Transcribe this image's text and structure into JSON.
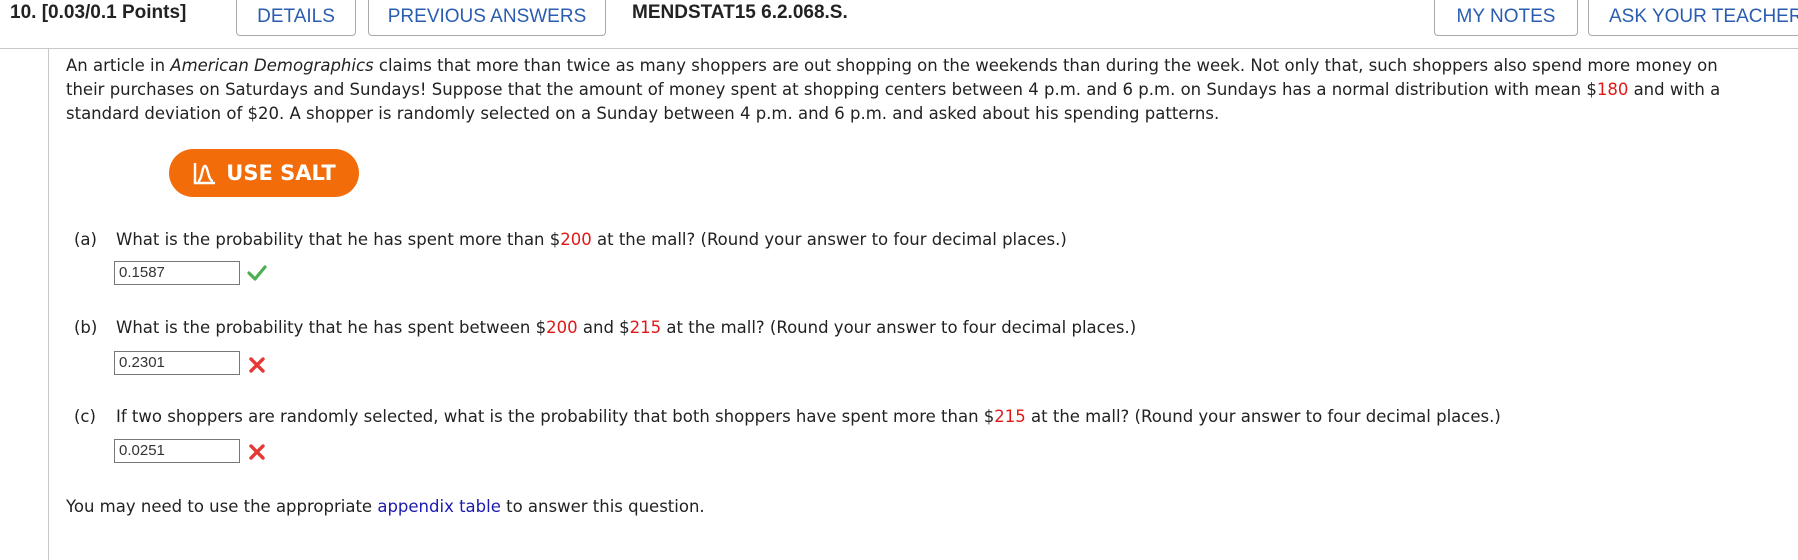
{
  "header": {
    "question_number": "10.",
    "points": "[0.03/0.1 Points]",
    "tabs": {
      "details": "DETAILS",
      "previous_answers": "PREVIOUS ANSWERS",
      "my_notes": "MY NOTES",
      "ask_teacher": "ASK YOUR TEACHER"
    },
    "code": "MENDSTAT15 6.2.068.S."
  },
  "intro": {
    "t1": "An article in ",
    "italic": "American Demographics",
    "t2": " claims that more than twice as many shoppers are out shopping on the weekends than during the week. Not only that, such shoppers also spend more money on their purchases on Saturdays and Sundays! Suppose that the amount of money spent at shopping centers between 4 p.m. and 6 p.m. on Sundays has a normal distribution with mean $",
    "mean": "180",
    "t3": " and with a standard deviation of $20. A shopper is randomly selected on a Sunday between 4 p.m. and 6 p.m. and asked about his spending patterns."
  },
  "salt_button": {
    "label": "USE SALT",
    "icon": "salt-chart-icon"
  },
  "parts": [
    {
      "letter": "(a)",
      "pre": "What is the probability that he has spent more than $",
      "v1": "200",
      "post": " at the mall? (Round your answer to four decimal places.)",
      "answer": "0.1587",
      "status": "correct"
    },
    {
      "letter": "(b)",
      "pre": "What is the probability that he has spent between $",
      "v1": "200",
      "mid": " and $",
      "v2": "215",
      "post": " at the mall? (Round your answer to four decimal places.)",
      "answer": "0.2301",
      "status": "incorrect"
    },
    {
      "letter": "(c)",
      "pre": "If two shoppers are randomly selected, what is the probability that both shoppers have spent more than $",
      "v1": "215",
      "post": " at the mall? (Round your answer to four decimal places.)",
      "answer": "0.0251",
      "status": "incorrect"
    }
  ],
  "footer": {
    "pre": "You may need to use the appropriate ",
    "link": "appendix table",
    "post": " to answer this question."
  },
  "colors": {
    "accent_link": "#2a5db0",
    "salt_orange": "#f36c0a",
    "value_red": "#e01818",
    "correct_green": "#4caf50",
    "incorrect_red": "#e53935"
  }
}
